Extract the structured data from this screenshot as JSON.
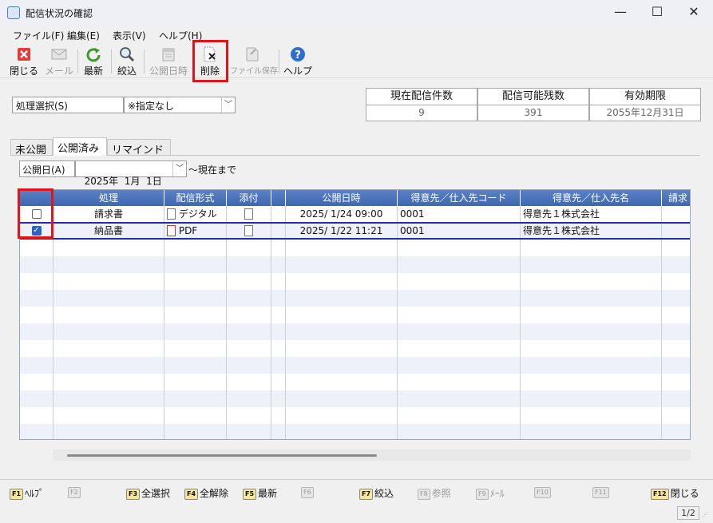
{
  "window": {
    "title": "配信状況の確認",
    "min_glyph": "—",
    "max_glyph": "☐",
    "close_glyph": "✕"
  },
  "menu": [
    "ファイル(F)",
    "編集(E)",
    "表示(V)",
    "ヘルプ(H)"
  ],
  "toolbar": {
    "close": "閉じる",
    "mail": "メール",
    "refresh": "最新",
    "filter": "絞込",
    "publish_date": "公開日時",
    "delete": "削除",
    "file_save": "ファイル保存",
    "help": "ヘルプ"
  },
  "selector": {
    "label": "処理選択(S)",
    "value": "※指定なし"
  },
  "stats": {
    "current_count": {
      "label": "現在配信件数",
      "value": "9"
    },
    "available": {
      "label": "配信可能残数",
      "value": "391"
    },
    "expiry": {
      "label": "有効期限",
      "value": "2055年12月31日"
    }
  },
  "tabs": [
    "未公開",
    "公開済み",
    "リマインド"
  ],
  "active_tab": "公開済み",
  "date_filter": {
    "label": "公開日(A)",
    "value": "2025年  1月  1日",
    "suffix": "～現在まで"
  },
  "grid": {
    "columns": [
      "",
      "処理",
      "配信形式",
      "添付",
      "",
      "公開日時",
      "得意先／仕入先コード",
      "得意先／仕入先名",
      "請求"
    ],
    "rows": [
      {
        "checked": false,
        "process": "請求書",
        "format": "デジタル",
        "format_icon": "document-icon",
        "published": "2025/ 1/24 09:00",
        "code": "0001",
        "name": "得意先１株式会社"
      },
      {
        "checked": true,
        "process": "納品書",
        "format": "PDF",
        "format_icon": "pdf-icon",
        "published": "2025/ 1/22 11:21",
        "code": "0001",
        "name": "得意先１株式会社"
      }
    ]
  },
  "fkeys": [
    {
      "key": "F1",
      "label": "ﾍﾙﾌﾟ",
      "enabled": true
    },
    {
      "key": "F2",
      "label": "",
      "enabled": false
    },
    {
      "key": "F3",
      "label": "全選択",
      "enabled": true
    },
    {
      "key": "F4",
      "label": "全解除",
      "enabled": true
    },
    {
      "key": "F5",
      "label": "最新",
      "enabled": true
    },
    {
      "key": "F6",
      "label": "",
      "enabled": false
    },
    {
      "key": "F7",
      "label": "絞込",
      "enabled": true
    },
    {
      "key": "F8",
      "label": "参照",
      "enabled": false
    },
    {
      "key": "F9",
      "label": "ﾒｰﾙ",
      "enabled": false
    },
    {
      "key": "F10",
      "label": "",
      "enabled": false
    },
    {
      "key": "F11",
      "label": "",
      "enabled": false
    },
    {
      "key": "F12",
      "label": "閉じる",
      "enabled": true
    }
  ],
  "status": {
    "page": "1/2"
  }
}
